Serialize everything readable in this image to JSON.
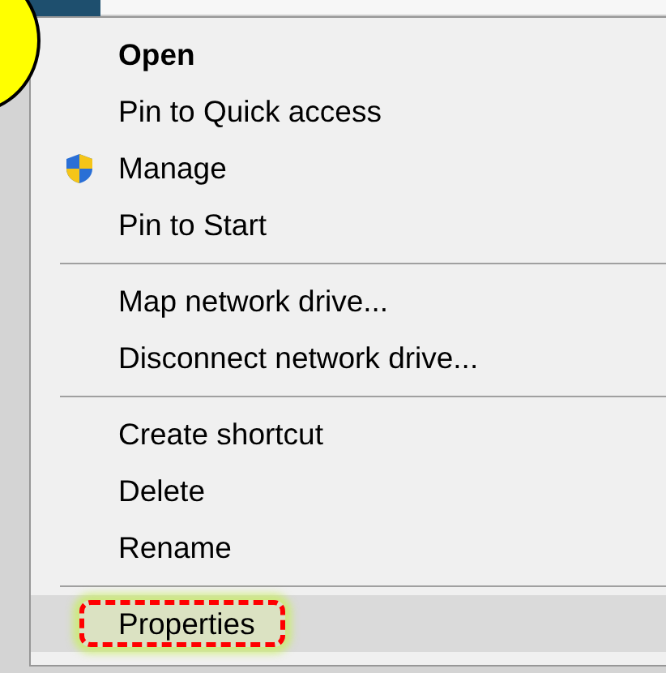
{
  "context_menu": {
    "items": [
      {
        "kind": "item",
        "label": "Open",
        "bold": true,
        "has_icon": false,
        "selected": false,
        "highlighted": false
      },
      {
        "kind": "item",
        "label": "Pin to Quick access",
        "bold": false,
        "has_icon": false,
        "selected": false,
        "highlighted": false
      },
      {
        "kind": "item",
        "label": "Manage",
        "bold": false,
        "has_icon": true,
        "selected": false,
        "highlighted": false
      },
      {
        "kind": "item",
        "label": "Pin to Start",
        "bold": false,
        "has_icon": false,
        "selected": false,
        "highlighted": false
      },
      {
        "kind": "separator"
      },
      {
        "kind": "item",
        "label": "Map network drive...",
        "bold": false,
        "has_icon": false,
        "selected": false,
        "highlighted": false
      },
      {
        "kind": "item",
        "label": "Disconnect network drive...",
        "bold": false,
        "has_icon": false,
        "selected": false,
        "highlighted": false
      },
      {
        "kind": "separator"
      },
      {
        "kind": "item",
        "label": "Create shortcut",
        "bold": false,
        "has_icon": false,
        "selected": false,
        "highlighted": false
      },
      {
        "kind": "item",
        "label": "Delete",
        "bold": false,
        "has_icon": false,
        "selected": false,
        "highlighted": false
      },
      {
        "kind": "item",
        "label": "Rename",
        "bold": false,
        "has_icon": false,
        "selected": false,
        "highlighted": false
      },
      {
        "kind": "separator"
      },
      {
        "kind": "item",
        "label": "Properties",
        "bold": false,
        "has_icon": false,
        "selected": true,
        "highlighted": true
      }
    ]
  }
}
